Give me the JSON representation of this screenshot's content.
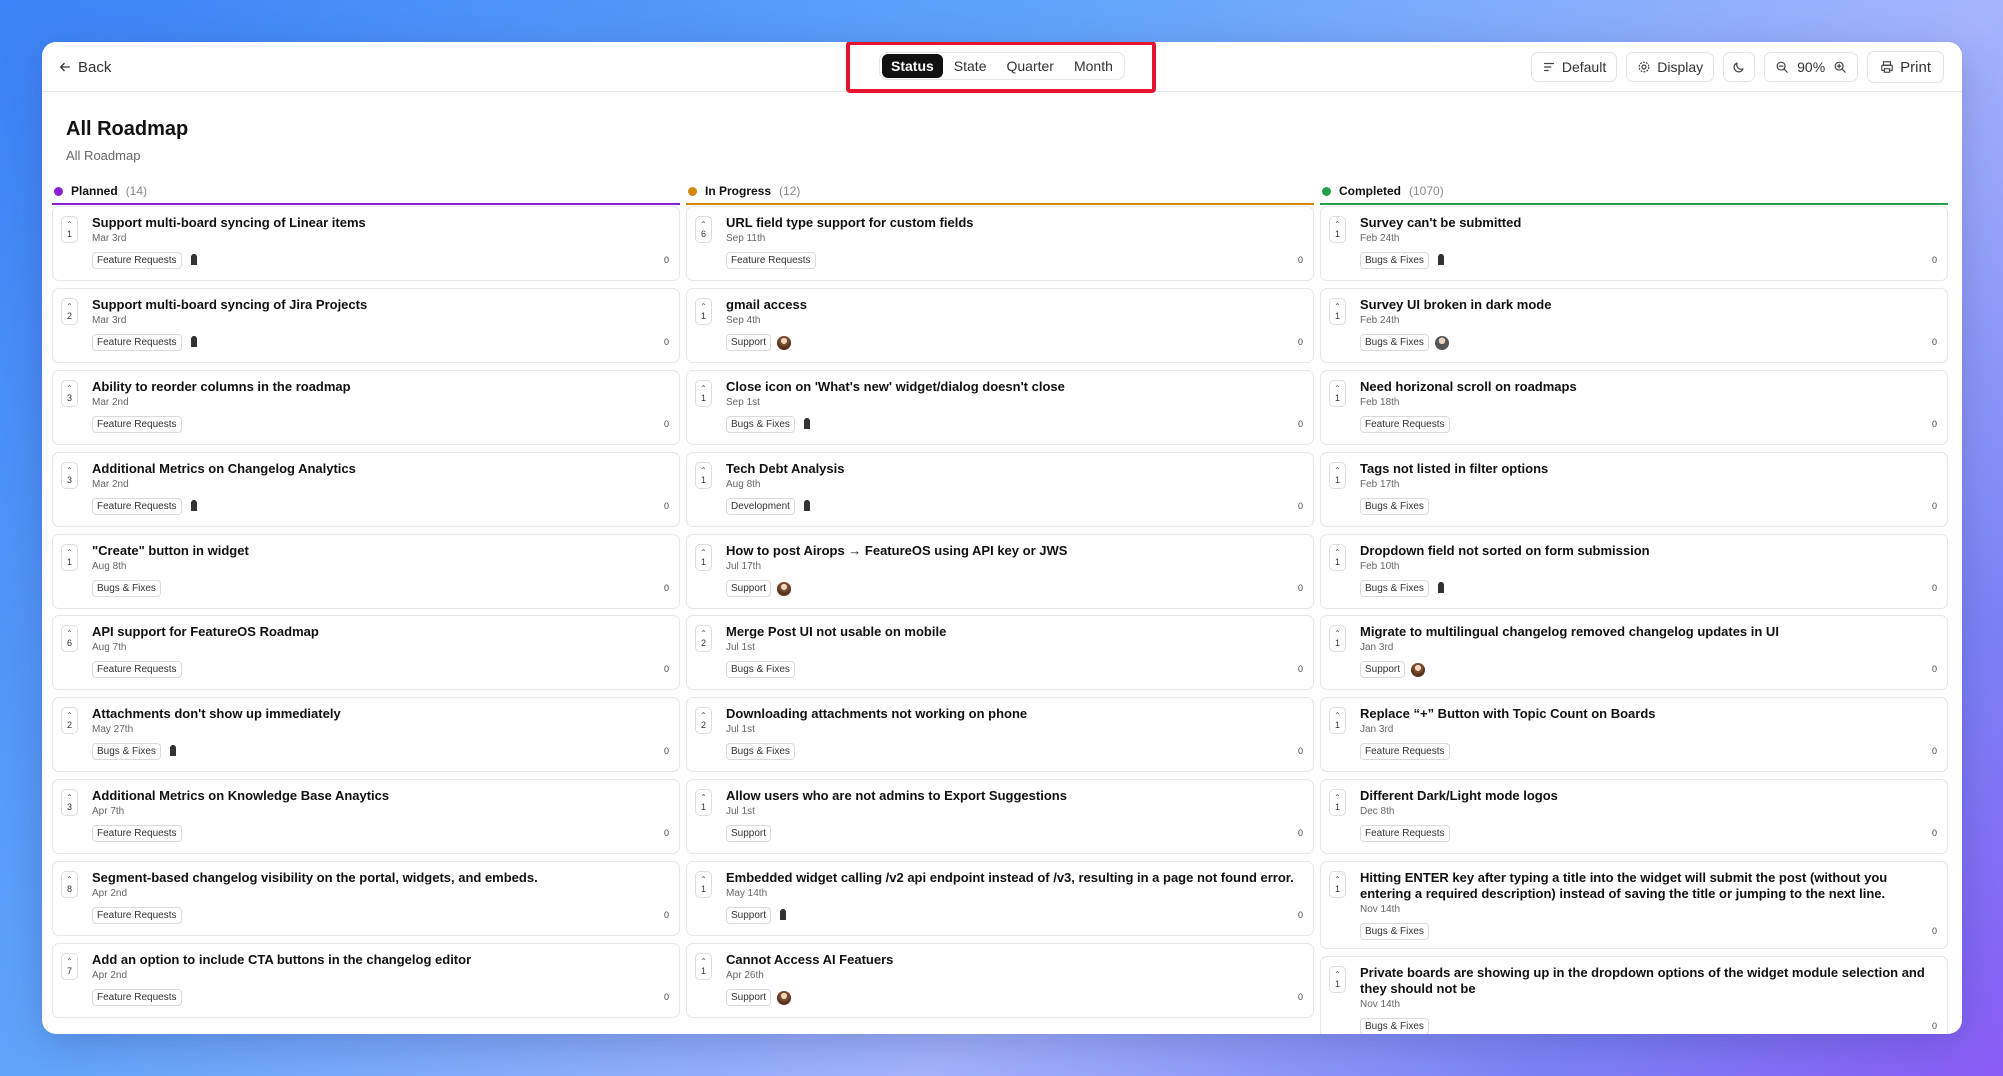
{
  "toolbar": {
    "back_label": "Back",
    "view_tabs": [
      {
        "label": "Status",
        "active": true
      },
      {
        "label": "State",
        "active": false
      },
      {
        "label": "Quarter",
        "active": false
      },
      {
        "label": "Month",
        "active": false
      }
    ],
    "default_label": "Default",
    "display_label": "Display",
    "zoom": "90%",
    "print_label": "Print",
    "icons": [
      "arrow-left-icon",
      "sort-icon",
      "gear-icon",
      "moon-icon",
      "zoom-out-icon",
      "zoom-in-icon",
      "printer-icon"
    ]
  },
  "page": {
    "title": "All Roadmap",
    "subtitle": "All Roadmap"
  },
  "colors": {
    "planned": "#7e22ce",
    "in_progress": "#ca8a04",
    "completed": "#16a34a",
    "highlight": "#e8132e"
  },
  "columns": [
    {
      "name": "Planned",
      "count": "(14)",
      "color": "#8b1fd6",
      "cards": [
        {
          "votes": "1",
          "title": "Support multi-board syncing of Linear items",
          "date": "Mar 3rd",
          "tag": "Feature Requests",
          "avatar": "bot",
          "comments": "0"
        },
        {
          "votes": "2",
          "title": "Support multi-board syncing of Jira Projects",
          "date": "Mar 3rd",
          "tag": "Feature Requests",
          "avatar": "bot",
          "comments": "0"
        },
        {
          "votes": "3",
          "title": "Ability to reorder columns in the roadmap",
          "date": "Mar 2nd",
          "tag": "Feature Requests",
          "avatar": "",
          "comments": "0"
        },
        {
          "votes": "3",
          "title": "Additional Metrics on Changelog Analytics",
          "date": "Mar 2nd",
          "tag": "Feature Requests",
          "avatar": "bot",
          "comments": "0"
        },
        {
          "votes": "1",
          "title": "\"Create\" button in widget",
          "date": "Aug 8th",
          "tag": "Bugs & Fixes",
          "avatar": "",
          "comments": "0"
        },
        {
          "votes": "6",
          "title": "API support for FeatureOS Roadmap",
          "date": "Aug 7th",
          "tag": "Feature Requests",
          "avatar": "",
          "comments": "0"
        },
        {
          "votes": "2",
          "title": "Attachments don't show up immediately",
          "date": "May 27th",
          "tag": "Bugs & Fixes",
          "avatar": "bot",
          "comments": "0"
        },
        {
          "votes": "3",
          "title": "Additional Metrics on Knowledge Base Anaytics",
          "date": "Apr 7th",
          "tag": "Feature Requests",
          "avatar": "",
          "comments": "0"
        },
        {
          "votes": "8",
          "title": "Segment-based changelog visibility on the portal, widgets, and embeds.",
          "date": "Apr 2nd",
          "tag": "Feature Requests",
          "avatar": "",
          "comments": "0"
        },
        {
          "votes": "7",
          "title": "Add an option to include CTA buttons in the changelog editor",
          "date": "Apr 2nd",
          "tag": "Feature Requests",
          "avatar": "",
          "comments": "0"
        }
      ]
    },
    {
      "name": "In Progress",
      "count": "(12)",
      "color": "#d4890f",
      "cards": [
        {
          "votes": "6",
          "title": "URL field type support for custom fields",
          "date": "Sep 11th",
          "tag": "Feature Requests",
          "avatar": "",
          "comments": "0"
        },
        {
          "votes": "1",
          "title": "gmail access",
          "date": "Sep 4th",
          "tag": "Support",
          "avatar": "person",
          "comments": "0"
        },
        {
          "votes": "1",
          "title": "Close icon on 'What's new' widget/dialog doesn't close",
          "date": "Sep 1st",
          "tag": "Bugs & Fixes",
          "avatar": "bot",
          "comments": "0"
        },
        {
          "votes": "1",
          "title": "Tech Debt Analysis",
          "date": "Aug 8th",
          "tag": "Development",
          "avatar": "bot",
          "comments": "0"
        },
        {
          "votes": "1",
          "title": "How to post Airops → FeatureOS using API key or JWS",
          "date": "Jul 17th",
          "tag": "Support",
          "avatar": "person",
          "comments": "0"
        },
        {
          "votes": "2",
          "title": "Merge Post UI not usable on mobile",
          "date": "Jul 1st",
          "tag": "Bugs & Fixes",
          "avatar": "",
          "comments": "0"
        },
        {
          "votes": "2",
          "title": "Downloading attachments not working on phone",
          "date": "Jul 1st",
          "tag": "Bugs & Fixes",
          "avatar": "",
          "comments": "0"
        },
        {
          "votes": "1",
          "title": "Allow users who are not admins to Export Suggestions",
          "date": "Jul 1st",
          "tag": "Support",
          "avatar": "",
          "comments": "0"
        },
        {
          "votes": "1",
          "title": "Embedded widget calling /v2 api endpoint instead of /v3, resulting in a page not found error.",
          "date": "May 14th",
          "tag": "Support",
          "avatar": "bot",
          "comments": "0"
        },
        {
          "votes": "1",
          "title": "Cannot Access AI Featuers",
          "date": "Apr 26th",
          "tag": "Support",
          "avatar": "person",
          "comments": "0"
        }
      ]
    },
    {
      "name": "Completed",
      "count": "(1070)",
      "color": "#22a04a",
      "cards": [
        {
          "votes": "1",
          "title": "Survey can't be submitted",
          "date": "Feb 24th",
          "tag": "Bugs & Fixes",
          "avatar": "bot",
          "comments": "0"
        },
        {
          "votes": "1",
          "title": "Survey UI broken in dark mode",
          "date": "Feb 24th",
          "tag": "Bugs & Fixes",
          "avatar": "person2",
          "comments": "0"
        },
        {
          "votes": "1",
          "title": "Need horizonal scroll on roadmaps",
          "date": "Feb 18th",
          "tag": "Feature Requests",
          "avatar": "",
          "comments": "0"
        },
        {
          "votes": "1",
          "title": "Tags not listed in filter options",
          "date": "Feb 17th",
          "tag": "Bugs & Fixes",
          "avatar": "",
          "comments": "0"
        },
        {
          "votes": "1",
          "title": "Dropdown field not sorted on form submission",
          "date": "Feb 10th",
          "tag": "Bugs & Fixes",
          "avatar": "bot",
          "comments": "0"
        },
        {
          "votes": "1",
          "title": "Migrate to multilingual changelog removed changelog updates in UI",
          "date": "Jan 3rd",
          "tag": "Support",
          "avatar": "person",
          "comments": "0"
        },
        {
          "votes": "1",
          "title": "Replace “+” Button with Topic Count on Boards",
          "date": "Jan 3rd",
          "tag": "Feature Requests",
          "avatar": "",
          "comments": "0"
        },
        {
          "votes": "1",
          "title": "Different Dark/Light mode logos",
          "date": "Dec 8th",
          "tag": "Feature Requests",
          "avatar": "",
          "comments": "0"
        },
        {
          "votes": "1",
          "title": "Hitting ENTER key after typing a title into the widget will submit the post (without you entering a required description) instead of saving the title or jumping to the next line.",
          "date": "Nov 14th",
          "tag": "Bugs & Fixes",
          "avatar": "",
          "comments": "0"
        },
        {
          "votes": "1",
          "title": "Private boards are showing up in the dropdown options of the widget module selection and they should not be",
          "date": "Nov 14th",
          "tag": "Bugs & Fixes",
          "avatar": "",
          "comments": "0"
        }
      ]
    }
  ]
}
